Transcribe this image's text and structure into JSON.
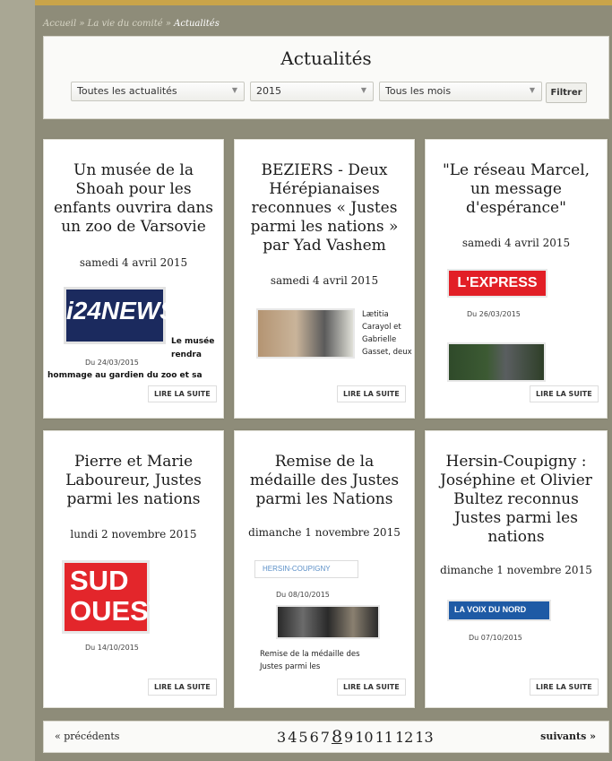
{
  "breadcrumb": {
    "home": "Accueil",
    "sep1": " » ",
    "section": "La vie du comité",
    "sep2": " » ",
    "current": "Actualités"
  },
  "page_title": "Actualités",
  "filters": {
    "category": "Toutes les actualités",
    "year": "2015",
    "month": "Tous les mois",
    "submit": "Filtrer"
  },
  "cards": [
    {
      "title": "Un musée de la Shoah pour les enfants ouvrira dans un zoo de Varsovie",
      "date": "samedi 4 avril 2015",
      "logo": "i24NEWS",
      "source_date": "Du 24/03/2015",
      "excerpt1": "Le musée",
      "excerpt2": "rendra",
      "excerpt3": "hommage au gardien du zoo et sa",
      "more": "LIRE LA SUITE"
    },
    {
      "title": "BEZIERS - Deux Hérépianaises reconnues « Justes parmi les nations » par Yad Vashem",
      "date": "samedi 4 avril 2015",
      "excerpt": "Lætitia Carayol et Gabrielle Gasset, deux",
      "more": "LIRE LA SUITE"
    },
    {
      "title": "\"Le réseau Marcel, un message d'espérance\"",
      "date": "samedi 4 avril 2015",
      "logo": "L'EXPRESS",
      "source_date": "Du 26/03/2015",
      "more": "LIRE LA SUITE"
    },
    {
      "title": "Pierre et Marie Laboureur, Justes parmi les nations",
      "date": "lundi 2 novembre 2015",
      "logo1": "SUD",
      "logo2": "OUEST",
      "source_date": "Du 14/10/2015",
      "more": "LIRE LA SUITE"
    },
    {
      "title": "Remise de la médaille des Justes parmi les Nations",
      "date": "dimanche 1 novembre 2015",
      "logo": "HERSIN-COUPIGNY",
      "source_date": "Du 08/10/2015",
      "excerpt": "Remise de la médaille des Justes parmi les",
      "more": "LIRE LA SUITE"
    },
    {
      "title": "Hersin-Coupigny : Joséphine et Olivier Bultez reconnus Justes parmi les nations",
      "date": "dimanche 1 novembre 2015",
      "logo": "LA VOIX DU NORD",
      "source_date": "Du 07/10/2015",
      "more": "LIRE LA SUITE"
    }
  ],
  "pager": {
    "prev": "« précédents",
    "next": "suivants »",
    "pages": [
      "3",
      "4",
      "5",
      "6",
      "7",
      "8",
      "9",
      "10",
      "11",
      "12",
      "13"
    ],
    "current": "8"
  }
}
